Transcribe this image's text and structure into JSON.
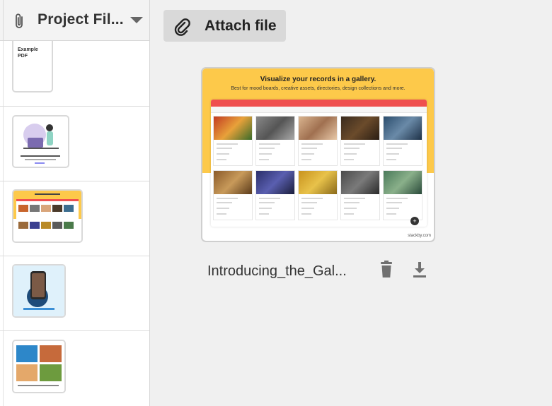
{
  "column": {
    "title": "Project Fil...",
    "icon": "paperclip-icon",
    "menu_icon": "caret-down-icon"
  },
  "cells": [
    {
      "thumb_text_1": "Example",
      "thumb_text_2": "PDF"
    },
    {
      "thumb_kind": "illustration"
    },
    {
      "thumb_kind": "gallery"
    },
    {
      "thumb_kind": "person"
    },
    {
      "thumb_kind": "landscape"
    }
  ],
  "toolbar": {
    "attach_label": "Attach file",
    "attach_icon": "paperclip-icon"
  },
  "preview": {
    "headline": "Visualize your records in a gallery.",
    "subline": "Best for mood boards, creative assets, directories, design collections and more.",
    "brand": "stackby.com",
    "accent_color": "#fdc94a",
    "appbar_color": "#ef4f4f"
  },
  "attachment": {
    "filename": "Introducing_the_Gal...",
    "delete_icon": "trash-icon",
    "download_icon": "download-icon"
  }
}
